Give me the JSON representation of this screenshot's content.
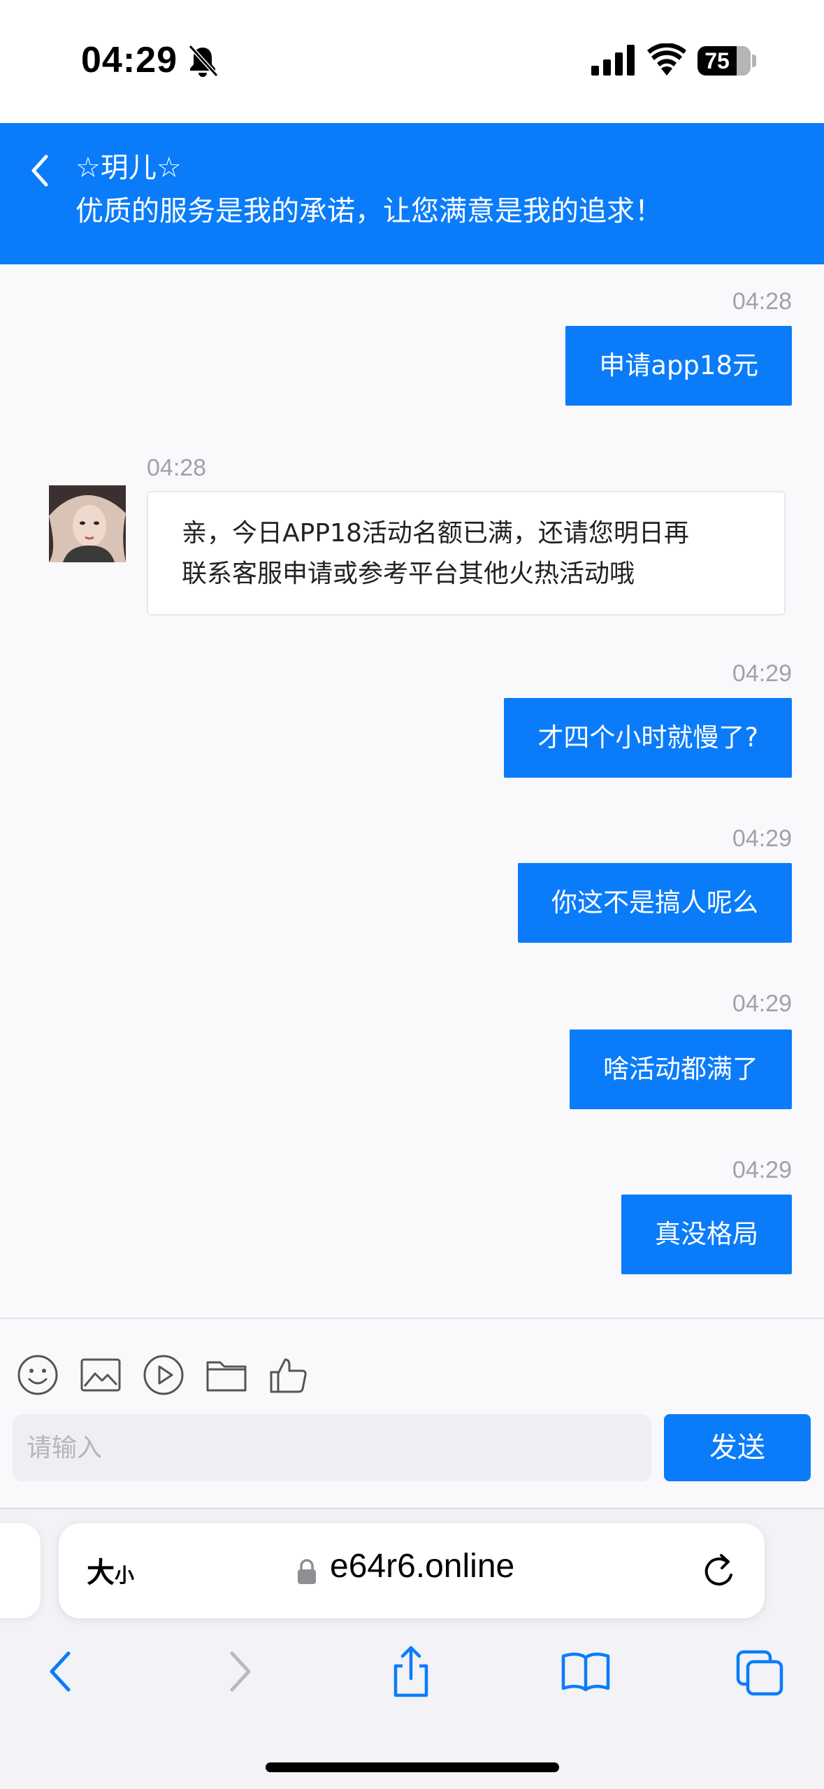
{
  "status_bar": {
    "time": "04:29",
    "battery": "75"
  },
  "chat_header": {
    "agent_name": "☆玥儿☆",
    "slogan": "优质的服务是我的承诺，让您满意是我的追求！"
  },
  "messages": [
    {
      "direction": "out",
      "time": "04:28",
      "text": "申请app18元"
    },
    {
      "direction": "in",
      "time": "04:28",
      "lines": [
        "亲，今日APP18活动名额已满，还请您明日再",
        "联系客服申请或参考平台其他火热活动哦"
      ]
    },
    {
      "direction": "out",
      "time": "04:29",
      "text": "才四个小时就慢了?"
    },
    {
      "direction": "out",
      "time": "04:29",
      "text": "你这不是搞人呢么"
    },
    {
      "direction": "out",
      "time": "04:29",
      "text": "啥活动都满了"
    },
    {
      "direction": "out",
      "time": "04:29",
      "text": "真没格局"
    }
  ],
  "composer": {
    "placeholder": "请输入",
    "send_label": "发送",
    "tools": [
      "emoji-icon",
      "image-icon",
      "video-icon",
      "folder-icon",
      "thumbs-up-icon"
    ]
  },
  "browser": {
    "text_size_big": "大",
    "text_size_small": "小",
    "url": "e64r6.online"
  },
  "colors": {
    "accent": "#0a7cfa",
    "chat_background": "#f9f9fb",
    "timestamp": "#9ea3a8"
  }
}
